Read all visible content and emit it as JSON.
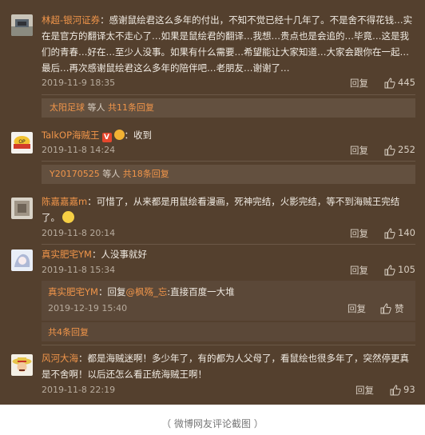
{
  "comments": [
    {
      "username": "林超-银河证券",
      "separator": "：",
      "text": "感谢鼠绘君这么多年的付出，不知不觉已经十几年了。不是舍不得花钱…实在是官方的翻译太不走心了…如果是鼠绘君的翻译…我想…贵点也是会追的…毕竟…这是我们的青春…好在…至少人没事。如果有什么需要…希望能让大家知道…大家会跟你在一起…最后…再次感谢鼠绘君这么多年的陪伴吧…老朋友…谢谢了…",
      "date": "2019-11-9 18:35",
      "reply_label": "回复",
      "likes": "445",
      "sub_bar": {
        "user": "太阳足球",
        "middle": " 等人 ",
        "count_text": "共11条回复"
      }
    },
    {
      "username": "TalkOP海贼王",
      "separator": "：",
      "text": "收到",
      "badge_v": "V",
      "date": "2019-11-8 14:24",
      "reply_label": "回复",
      "likes": "252",
      "sub_bar": {
        "user": "Y20170525",
        "middle": " 等人 ",
        "count_text": "共18条回复"
      }
    },
    {
      "username": "陈嘉嘉嘉m",
      "separator": "：",
      "text": "可惜了，从来都是用鼠绘看漫画，死神完结，火影完结，等不到海贼王完结了。",
      "date": "2019-11-8 20:14",
      "reply_label": "回复",
      "likes": "140"
    },
    {
      "username": "真实肥宅YM",
      "separator": "：",
      "text": "人没事就好",
      "date": "2019-11-8 15:34",
      "reply_label": "回复",
      "likes": "105",
      "nested_reply": {
        "username": "真实肥宅YM",
        "prefix": "：回复",
        "mention": "@枫殇_忘",
        "text": ":直接百度一大堆",
        "date": "2019-12-19 15:40",
        "reply_label": "回复",
        "like_label": "赞"
      },
      "more_replies": "共4条回复"
    },
    {
      "username": "风河大海",
      "separator": "：",
      "text": "都是海贼迷啊！多少年了，有的都为人父母了，看鼠绘也很多年了，突然停更真是不舍啊！以后还怎么看正统海贼王啊！",
      "date": "2019-11-8 22:19",
      "reply_label": "回复",
      "likes": "93"
    }
  ],
  "caption": "（ 微博网友评论截图 ）",
  "colors": {
    "background": "#54402e",
    "username": "#f0954a",
    "text": "#f1ebe3",
    "meta": "#b7ab9d"
  },
  "icons": {
    "like": "thumbs-up-icon",
    "verified": "verified-v-icon",
    "emoji": "emoji-icon"
  }
}
